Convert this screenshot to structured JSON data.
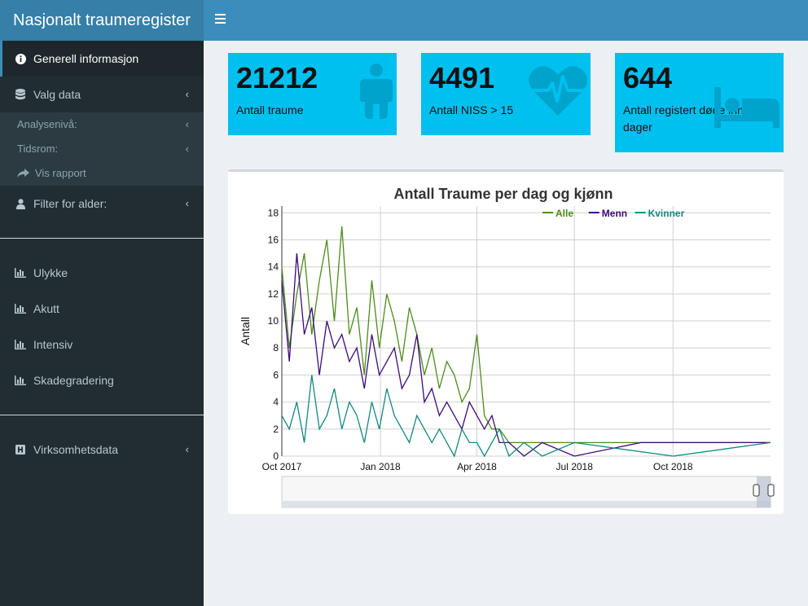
{
  "app": {
    "title": "Nasjonalt traumeregister"
  },
  "sidebar": {
    "items": [
      {
        "label": "Generell informasjon"
      },
      {
        "label": "Valg data"
      },
      {
        "label": "Filter for alder:"
      },
      {
        "label": "Ulykke"
      },
      {
        "label": "Akutt"
      },
      {
        "label": "Intensiv"
      },
      {
        "label": "Skadegradering"
      },
      {
        "label": "Virksomhetsdata"
      }
    ],
    "subitems": [
      {
        "label": "Analysenivå:"
      },
      {
        "label": "Tidsrom:"
      },
      {
        "label": "Vis rapport"
      }
    ]
  },
  "boxes": [
    {
      "value": "21212",
      "label": "Antall traume",
      "icon": "male-icon"
    },
    {
      "value": "4491",
      "label": "Antall NISS > 15",
      "icon": "heartbeat-icon"
    },
    {
      "value": "644",
      "label": "Antall registert døde innen 30 dager",
      "icon": "bed-icon"
    }
  ],
  "colors": {
    "box": "#00c0ef",
    "header": "#3c8dbc",
    "alle": "#4d8b1a",
    "menn": "#3b0a7a",
    "kvinner": "#13887f"
  },
  "chart_data": {
    "type": "line",
    "title": "Antall Traume per dag og kjønn",
    "xlabel": "",
    "ylabel": "Antall",
    "ylim": [
      0,
      18.5
    ],
    "xlim": [
      "2017-10-01",
      "2018-12-31"
    ],
    "yticks": [
      0,
      2,
      4,
      6,
      8,
      10,
      12,
      14,
      16,
      18
    ],
    "xticks": [
      "Oct 2017",
      "Jan 2018",
      "Apr 2018",
      "Jul 2018",
      "Oct 2018"
    ],
    "xtick_dates": [
      "2017-10-01",
      "2018-01-01",
      "2018-04-01",
      "2018-07-01",
      "2018-10-01"
    ],
    "legend_position": "top-right",
    "series": [
      {
        "name": "Alle",
        "x": [
          "2017-10-01",
          "2017-10-08",
          "2017-10-15",
          "2017-10-22",
          "2017-10-29",
          "2017-11-05",
          "2017-11-12",
          "2017-11-19",
          "2017-11-26",
          "2017-12-03",
          "2017-12-10",
          "2017-12-17",
          "2017-12-24",
          "2017-12-31",
          "2018-01-07",
          "2018-01-14",
          "2018-01-21",
          "2018-01-28",
          "2018-02-04",
          "2018-02-11",
          "2018-02-18",
          "2018-02-25",
          "2018-03-04",
          "2018-03-11",
          "2018-03-18",
          "2018-03-25",
          "2018-04-01",
          "2018-04-08",
          "2018-04-15",
          "2018-04-22",
          "2018-05-01",
          "2018-06-01",
          "2018-07-01",
          "2018-08-01",
          "2018-09-01",
          "2018-10-01",
          "2018-11-01",
          "2018-12-31"
        ],
        "values": [
          14,
          8,
          12,
          15,
          9,
          13,
          16,
          10,
          17,
          9,
          11,
          6,
          13,
          8,
          12,
          10,
          7,
          11,
          9,
          6,
          8,
          5,
          7,
          6,
          4,
          5,
          9,
          3,
          2,
          2,
          1,
          1,
          1,
          1,
          1,
          1,
          1,
          1
        ]
      },
      {
        "name": "Menn",
        "x": [
          "2017-10-01",
          "2017-10-08",
          "2017-10-15",
          "2017-10-22",
          "2017-10-29",
          "2017-11-05",
          "2017-11-12",
          "2017-11-19",
          "2017-11-26",
          "2017-12-03",
          "2017-12-10",
          "2017-12-17",
          "2017-12-24",
          "2017-12-31",
          "2018-01-07",
          "2018-01-14",
          "2018-01-21",
          "2018-01-28",
          "2018-02-04",
          "2018-02-11",
          "2018-02-18",
          "2018-02-25",
          "2018-03-04",
          "2018-03-11",
          "2018-03-18",
          "2018-03-25",
          "2018-04-01",
          "2018-04-08",
          "2018-04-15",
          "2018-04-22",
          "2018-05-01",
          "2018-05-15",
          "2018-06-01",
          "2018-07-01",
          "2018-09-01",
          "2018-12-31"
        ],
        "values": [
          13,
          7,
          15,
          9,
          11,
          6,
          10,
          8,
          9,
          7,
          8,
          5,
          9,
          6,
          7,
          8,
          5,
          6,
          9,
          4,
          5,
          3,
          4,
          3,
          2,
          4,
          3,
          2,
          3,
          1,
          1,
          0,
          1,
          0,
          1,
          1
        ]
      },
      {
        "name": "Kvinner",
        "x": [
          "2017-10-01",
          "2017-10-08",
          "2017-10-15",
          "2017-10-22",
          "2017-10-29",
          "2017-11-05",
          "2017-11-12",
          "2017-11-19",
          "2017-11-26",
          "2017-12-03",
          "2017-12-10",
          "2017-12-17",
          "2017-12-24",
          "2017-12-31",
          "2018-01-07",
          "2018-01-14",
          "2018-01-21",
          "2018-01-28",
          "2018-02-04",
          "2018-02-11",
          "2018-02-18",
          "2018-02-25",
          "2018-03-04",
          "2018-03-11",
          "2018-03-18",
          "2018-03-25",
          "2018-04-01",
          "2018-04-08",
          "2018-04-15",
          "2018-04-22",
          "2018-05-01",
          "2018-05-15",
          "2018-06-01",
          "2018-07-01",
          "2018-10-01",
          "2018-12-31"
        ],
        "values": [
          3,
          2,
          4,
          1,
          6,
          2,
          3,
          5,
          2,
          4,
          3,
          1,
          4,
          2,
          5,
          3,
          2,
          1,
          3,
          2,
          1,
          2,
          1,
          0,
          2,
          1,
          1,
          0,
          1,
          2,
          0,
          1,
          0,
          1,
          0,
          1
        ]
      }
    ]
  }
}
